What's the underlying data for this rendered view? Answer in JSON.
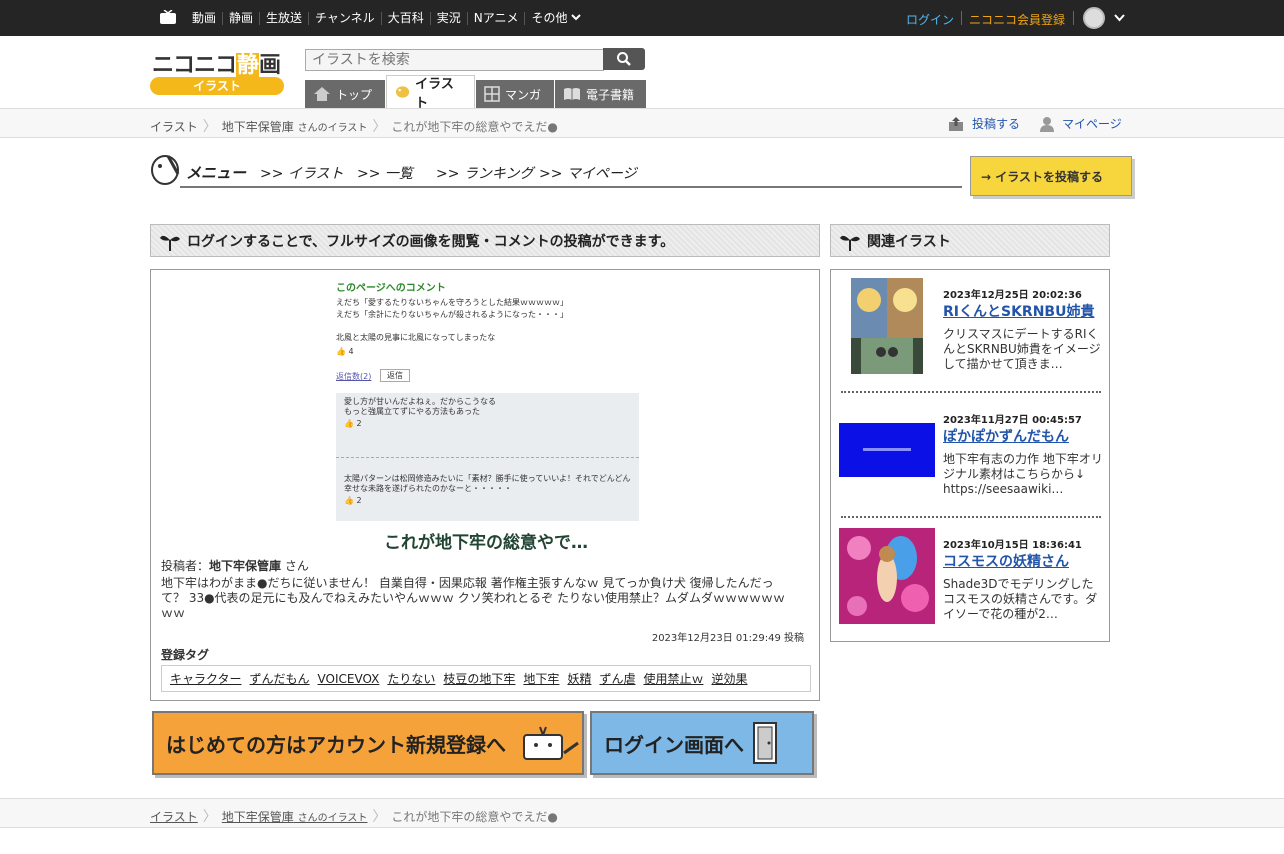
{
  "topnav": {
    "links": [
      "動画",
      "静画",
      "生放送",
      "チャンネル",
      "大百科",
      "実況",
      "Nアニメ",
      "その他"
    ],
    "login": "ログイン",
    "register": "ニコニコ会員登録"
  },
  "header": {
    "logo_text": "ニコニコ",
    "logo_highlight": "静",
    "logo_rest": "画",
    "logo_sub": "イラスト",
    "search_placeholder": "イラストを検索",
    "tabs": [
      "トップ",
      "イラスト",
      "マンガ",
      "電子書籍"
    ]
  },
  "breadcrumb": {
    "root": "イラスト",
    "user": "地下牢保管庫",
    "user_suffix": "さんのイラスト",
    "current": "これが地下牢の総意やでえだ●",
    "post": "投稿する",
    "mypage": "マイページ"
  },
  "menu": {
    "title": "メニュー",
    "items": [
      ">> イラスト",
      ">> 一覧",
      ">> ランキング",
      ">> マイページ"
    ],
    "post_button": "→ イラストを投稿する"
  },
  "main": {
    "notice": "ログインすることで、フルサイズの画像を閲覧・コメントの投稿ができます。",
    "thumb": {
      "comment_header": "このページへのコメント",
      "line1": "えだち「愛するたりないちゃんを守ろうとした結果ｗｗｗｗｗ」",
      "line2": "えだち「余計にたりないちゃんが殺されるようになった・・・」",
      "line3": "北風と太陽の見事に北風になってしまったな",
      "like1": "4",
      "replies": "返信数(2)",
      "reply_btn": "返信",
      "r1a": "愛し方が甘いんだよねぇ。だからこうなる",
      "r1b": "もっと強属立てずにやる方法もあった",
      "like2": "2",
      "r2": "太陽パターンは松岡修造みたいに「素材？勝手に使っていいよ！それでどんどん",
      "r2b": "幸せな未路を遂げられたのかなーと・・・・・",
      "like3": "2"
    },
    "title": "これが地下牢の総意やで…",
    "poster_label": "投稿者：",
    "poster_name": "地下牢保管庫",
    "poster_suffix": " さん",
    "description": "地下牢はわがまま●だちに従いません！ 自業自得・因果応報 著作権主張すんなｗ 見てっか負け犬 復帰したんだって？ 33●代表の足元にも及んでねえみたいやんｗｗｗ クソ笑われとるぞ たりない使用禁止？ムダムダｗｗｗｗｗｗｗｗ",
    "posted_at": "2023年12月23日 01:29:49 投稿",
    "tags_label": "登録タグ",
    "tags": [
      "キャラクター",
      "ずんだもん",
      "VOICEVOX",
      "たりない",
      "枝豆の地下牢",
      "地下牢",
      "妖精",
      "ずん虐",
      "使用禁止ｗ",
      "逆効果"
    ],
    "cta_register": "はじめての方はアカウント新規登録へ",
    "cta_login": "ログイン画面へ"
  },
  "side": {
    "title": "関連イラスト",
    "items": [
      {
        "date": "2023年12月25日 20:02:36",
        "title": "RIくんとSKRNBU姉貴",
        "summary": "クリスマスにデートするRIくんとSKRNBU姉貴をイメージして描かせて頂きま…"
      },
      {
        "date": "2023年11月27日 00:45:57",
        "title": "ぽかぽかずんだもん",
        "summary": "地下牢有志の力作 地下牢オリジナル素材はこちらから↓ https://seesaawiki…"
      },
      {
        "date": "2023年10月15日 18:36:41",
        "title": "コスモスの妖精さん",
        "summary": "Shade3Dでモデリングしたコスモスの妖精さんです。ダイソーで花の種が2…"
      }
    ]
  },
  "colors": {
    "topbar": "#252525",
    "login": "#55b6ee",
    "register": "#f0a414",
    "brand": "#f5b81a",
    "link": "#2255aa"
  }
}
